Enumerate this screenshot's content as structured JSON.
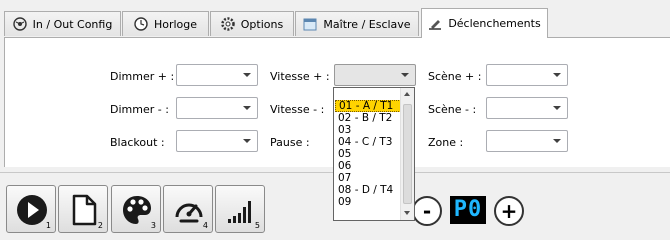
{
  "tabs": [
    {
      "label": "In / Out Config",
      "icon": "gauge-circle-icon"
    },
    {
      "label": "Horloge",
      "icon": "clock-icon"
    },
    {
      "label": "Options",
      "icon": "gear-icon"
    },
    {
      "label": "Maître / Esclave",
      "icon": "calendar-icon"
    },
    {
      "label": "Déclenchements",
      "icon": "pencil-ruler-icon",
      "active": true
    }
  ],
  "form": {
    "dimmer_plus": "Dimmer + :",
    "dimmer_minus": "Dimmer - :",
    "blackout": "Blackout :",
    "vitesse_plus": "Vitesse + :",
    "vitesse_minus": "Vitesse - :",
    "pause": "Pause :",
    "scene_plus": "Scène + :",
    "scene_minus": "Scène - :",
    "zone": "Zone :"
  },
  "dropdown": {
    "items": [
      "01 - A / T1",
      "02 - B / T2",
      "03",
      "04 - C / T3",
      "05",
      "06",
      "07",
      "08 - D / T4",
      "09"
    ],
    "selected_index": 0
  },
  "toolbar": {
    "buttons": [
      {
        "icon": "play-icon",
        "num": "1"
      },
      {
        "icon": "new-document-icon",
        "num": "2"
      },
      {
        "icon": "palette-icon",
        "num": "3"
      },
      {
        "icon": "speedometer-icon",
        "num": "4"
      },
      {
        "icon": "signal-bars-icon",
        "num": "5"
      }
    ],
    "minus_label": "-",
    "plus_label": "+",
    "display_value": "P0"
  },
  "colors": {
    "display_text": "#1fb7ff",
    "dropdown_selected": "#ffd400"
  }
}
